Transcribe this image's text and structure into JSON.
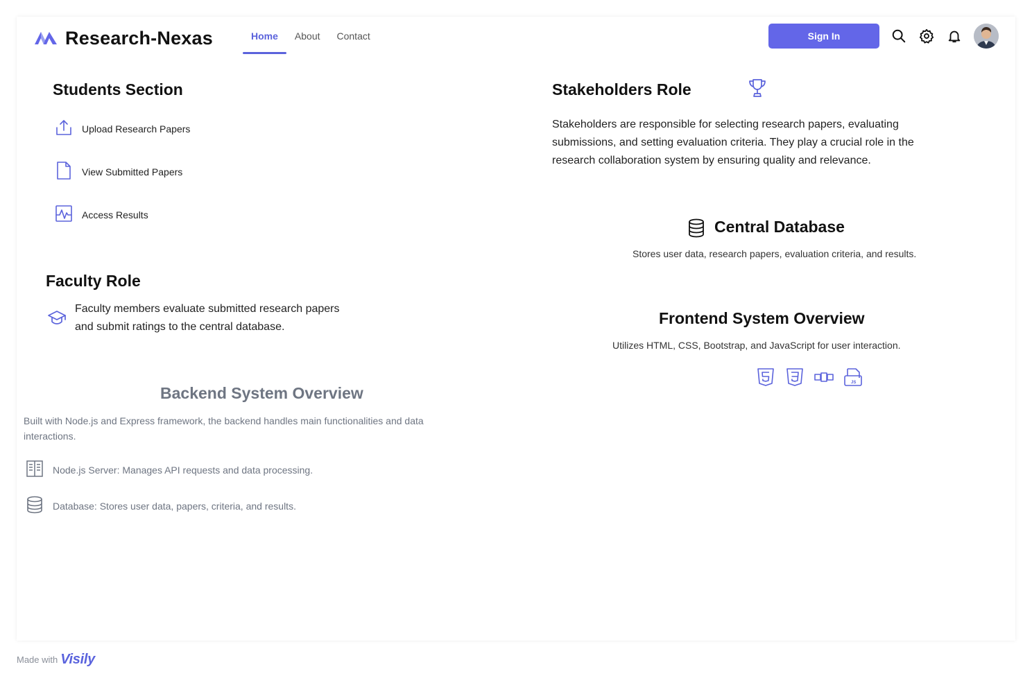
{
  "header": {
    "brand": "Research-Nexas",
    "nav": [
      {
        "label": "Home",
        "active": true
      },
      {
        "label": "About",
        "active": false
      },
      {
        "label": "Contact",
        "active": false
      }
    ],
    "signin_label": "Sign In",
    "icons": [
      "search-icon",
      "settings-icon",
      "bell-icon",
      "avatar"
    ]
  },
  "students": {
    "title": "Students Section",
    "items": [
      {
        "label": "Upload Research Papers",
        "icon": "upload-icon"
      },
      {
        "label": "View Submitted Papers",
        "icon": "file-icon"
      },
      {
        "label": "Access Results",
        "icon": "activity-icon"
      }
    ]
  },
  "faculty": {
    "title": "Faculty Role",
    "text": "Faculty members evaluate submitted research papers and submit ratings to the central database.",
    "icon": "graduation-cap-icon"
  },
  "stakeholders": {
    "title": "Stakeholders Role",
    "text": "Stakeholders are responsible for selecting research papers, evaluating submissions, and setting evaluation criteria. They play a crucial role in the research collaboration system by ensuring quality and relevance.",
    "icon": "trophy-icon"
  },
  "database": {
    "title": "Central Database",
    "text": "Stores user data, research papers, evaluation criteria, and results.",
    "icon": "database-icon"
  },
  "frontend": {
    "title": "Frontend System Overview",
    "text": "Utilizes HTML, CSS, Bootstrap, and JavaScript for user interaction.",
    "tech_icons": [
      "html5-icon",
      "css3-icon",
      "bootstrap-icon",
      "javascript-icon"
    ]
  },
  "backend": {
    "title": "Backend System Overview",
    "text": "Built with Node.js and Express framework, the backend handles main functionalities and data interactions.",
    "items": [
      {
        "label": "Node.js Server: Manages API requests and data processing.",
        "icon": "server-icon"
      },
      {
        "label": "Database: Stores user data, papers, criteria, and results.",
        "icon": "database-icon"
      }
    ]
  },
  "footer": {
    "made_with": "Made with",
    "brand": "Visily"
  },
  "colors": {
    "accent": "#6366e8",
    "muted_text": "#6e7582"
  }
}
